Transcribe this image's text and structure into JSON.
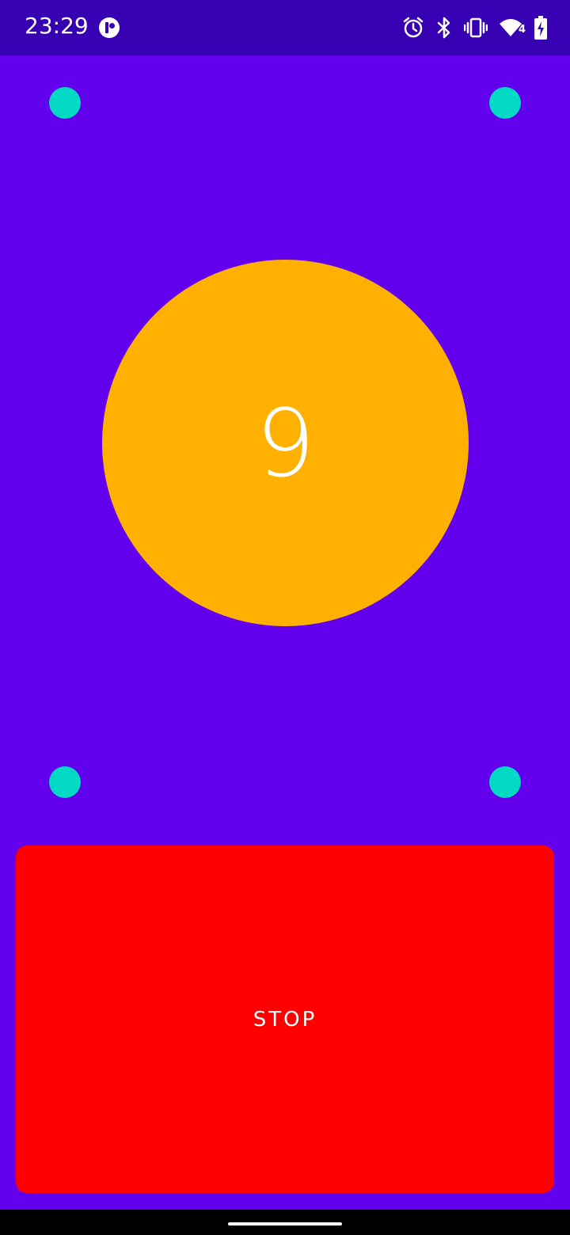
{
  "status_bar": {
    "time": "23:29",
    "network_badge": "4",
    "icons": [
      "app-badge-icon",
      "alarm-icon",
      "bluetooth-icon",
      "vibrate-icon",
      "wifi-icon",
      "battery-charging-icon"
    ]
  },
  "counter": {
    "value": "9"
  },
  "stop_button": {
    "label": "STOP"
  },
  "colors": {
    "background": "#6200EE",
    "status_bar": "#3700B3",
    "dot": "#03DAC5",
    "circle": "#FFB000",
    "stop_button": "#FF0000",
    "nav_bar": "#000000"
  }
}
